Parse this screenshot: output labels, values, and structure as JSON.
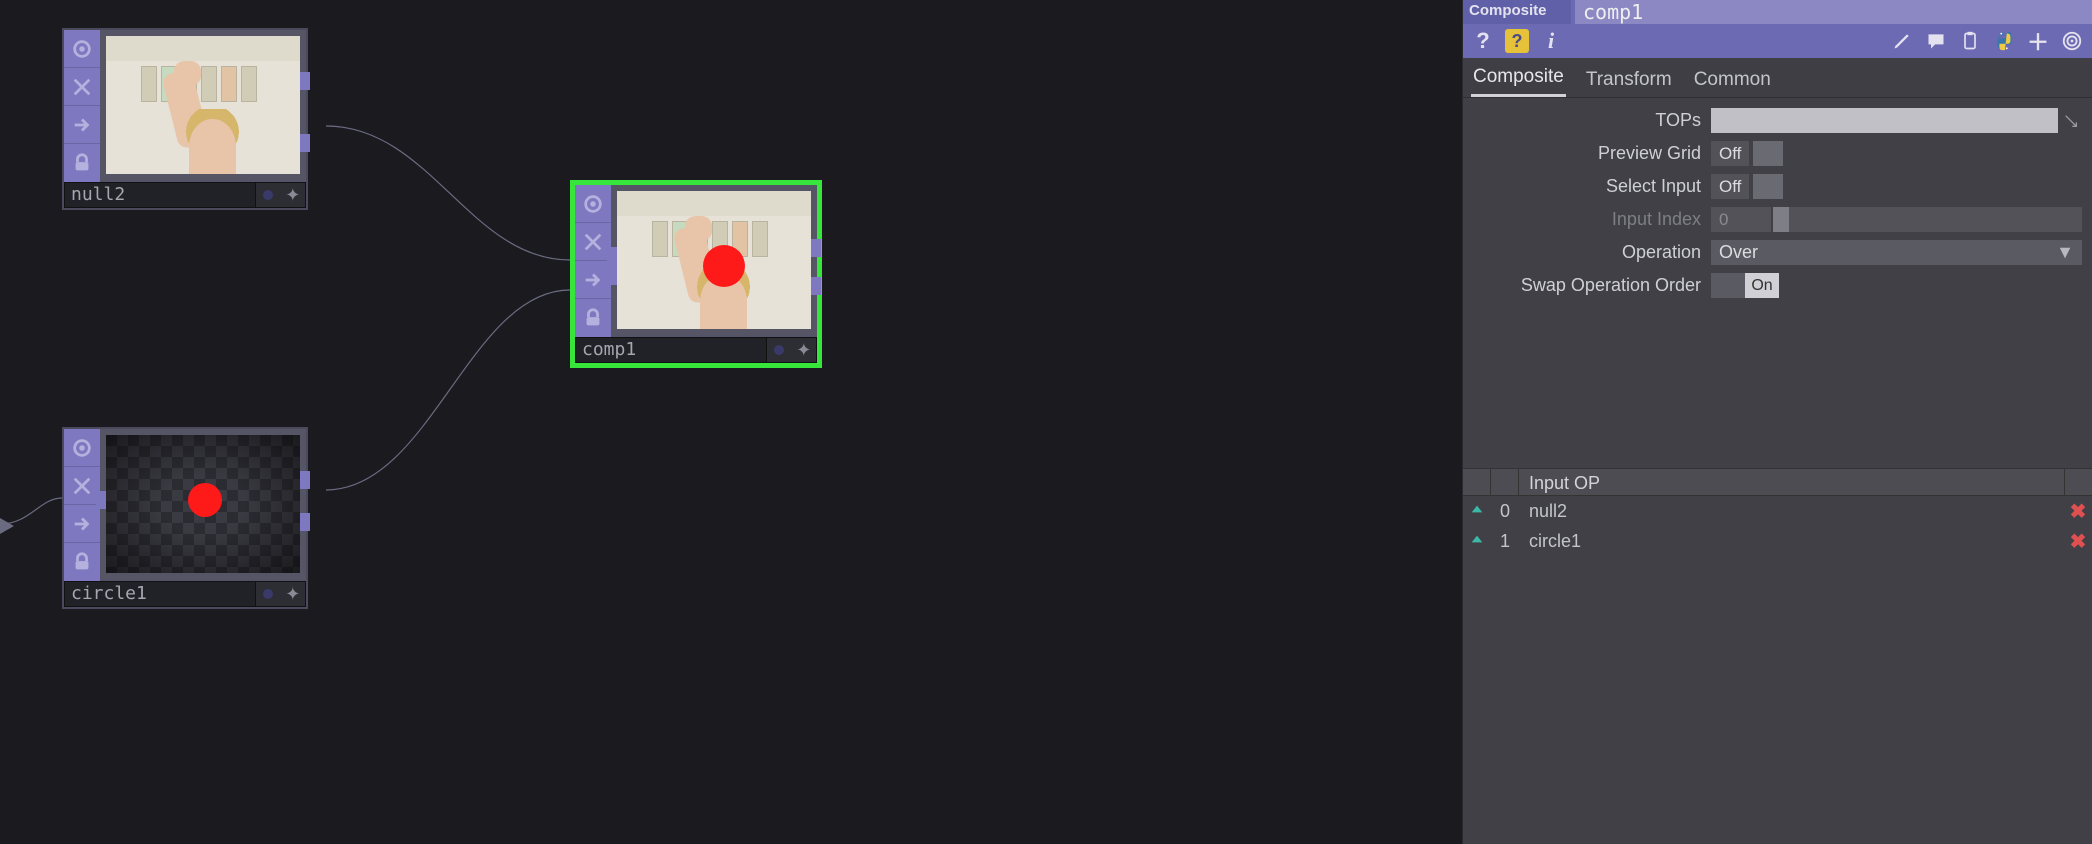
{
  "network": {
    "nodes": {
      "null2": {
        "name": "null2"
      },
      "circle1": {
        "name": "circle1"
      },
      "comp1": {
        "name": "comp1",
        "selected": true
      }
    }
  },
  "panel": {
    "op_type": "Composite",
    "op_name": "comp1",
    "tabs": [
      {
        "label": "Composite",
        "active": true
      },
      {
        "label": "Transform",
        "active": false
      },
      {
        "label": "Common",
        "active": false
      }
    ],
    "params": {
      "tops": {
        "label": "TOPs",
        "value": ""
      },
      "preview_grid": {
        "label": "Preview Grid",
        "value": "Off"
      },
      "select_input": {
        "label": "Select Input",
        "value": "Off"
      },
      "input_index": {
        "label": "Input Index",
        "value": "0",
        "enabled": false
      },
      "operation": {
        "label": "Operation",
        "value": "Over"
      },
      "swap_order": {
        "label": "Swap Operation Order",
        "value": "On"
      }
    },
    "input_table": {
      "header": "Input OP",
      "rows": [
        {
          "index": "0",
          "name": "null2"
        },
        {
          "index": "1",
          "name": "circle1"
        }
      ]
    }
  }
}
